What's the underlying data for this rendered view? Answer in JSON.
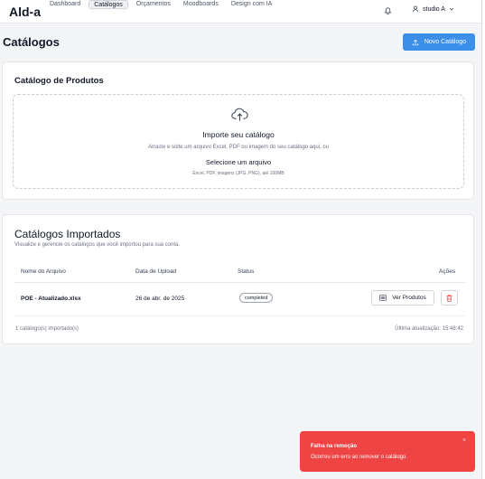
{
  "app": {
    "brand": "Ald-a"
  },
  "nav": {
    "items": [
      {
        "label": "Dashboard",
        "active": false
      },
      {
        "label": "Catálogos",
        "active": true
      },
      {
        "label": "Orçamentos",
        "active": false
      },
      {
        "label": "Moodboards",
        "active": false
      },
      {
        "label": "Design com IA",
        "active": false
      }
    ]
  },
  "user": {
    "name": "studio A"
  },
  "page": {
    "title": "Catálogos",
    "new_button": "Novo Catálogo"
  },
  "product_catalog": {
    "title": "Catálogo de Produtos",
    "dropzone": {
      "title": "Importe seu catálogo",
      "subtitle": "Arraste e solte um arquivo Excel, PDF ou imagem do seu catálogo aqui, ou",
      "select_label": "Selecione um arquivo",
      "hint": "Excel, PDF, imagens (JPG, PNG), até 100MB"
    }
  },
  "imported": {
    "title": "Catálogos Importados",
    "subtitle": "Visualize e gerencie os catálogos que você importou para sua conta.",
    "columns": {
      "file": "Nome do Arquivo",
      "date": "Data de Upload",
      "status": "Status",
      "actions": "Ações"
    },
    "rows": [
      {
        "file": "POE - Atualizado.xlsx",
        "date": "26 de abr. de 2025",
        "status": "completed",
        "view_label": "Ver Produtos"
      }
    ],
    "count_text": "1 catálogo(s) importado(s)",
    "updated_text": "Última atualização: 15:48:42"
  },
  "toast": {
    "title": "Falha na remoção",
    "message": "Ocorreu um erro ao remover o catálogo.",
    "close": "×",
    "color": "#ef4444"
  },
  "colors": {
    "primary": "#3b8fe8",
    "danger": "#ef4444"
  }
}
